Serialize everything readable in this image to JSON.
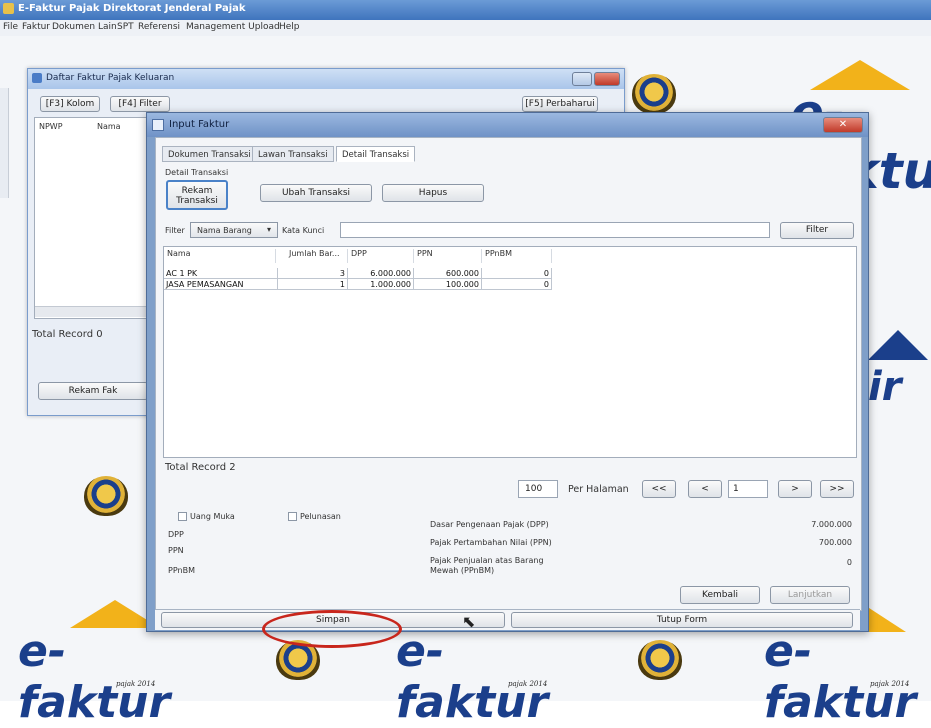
{
  "app": {
    "title": "E-Faktur Pajak Direktorat Jenderal Pajak",
    "menu": [
      "File",
      "Faktur",
      "Dokumen Lain",
      "SPT",
      "Referensi",
      "Management Upload",
      "Help"
    ]
  },
  "branding": {
    "logo_word": "e-faktur",
    "logo_sub": "pajak 2014"
  },
  "daftar_window": {
    "title": "Daftar Faktur Pajak Keluaran",
    "btn_kolom": "[F3] Kolom",
    "btn_filter": "[F4] Filter",
    "btn_perbaharui": "[F5] Perbaharui",
    "col_npwp": "NPWP",
    "col_nama": "Nama",
    "total_record": "Total Record 0",
    "rekam_faktur": "Rekam Fak"
  },
  "input_faktur": {
    "title": "Input Faktur",
    "tabs": [
      "Dokumen Transaksi",
      "Lawan Transaksi",
      "Detail Transaksi"
    ],
    "group_label": "Detail Transaksi",
    "btn_rekam": "Rekam Transaksi",
    "btn_ubah": "Ubah Transaksi",
    "btn_hapus": "Hapus",
    "filter_label": "Filter",
    "filter_field": "Nama Barang",
    "kata_kunci": "Kata Kunci",
    "btn_filter": "Filter",
    "columns": [
      "Nama",
      "Jumlah Bar...",
      "DPP",
      "PPN",
      "PPnBM"
    ],
    "rows": [
      {
        "nama": "AC 1 PK",
        "jumlah": "3",
        "dpp": "6.000.000",
        "ppn": "600.000",
        "ppnbm": "0"
      },
      {
        "nama": "JASA PEMASANGAN",
        "jumlah": "1",
        "dpp": "1.000.000",
        "ppn": "100.000",
        "ppnbm": "0"
      }
    ],
    "total_record": "Total Record 2",
    "per_halaman_value": "100",
    "per_halaman_label": "Per Halaman",
    "page_value": "1",
    "nav": {
      "first": "<<",
      "prev": "<",
      "next": ">",
      "last": ">>"
    },
    "uang_muka": "Uang Muka",
    "pelunasan": "Pelunasan",
    "left_labels": [
      "DPP",
      "PPN",
      "PPnBM"
    ],
    "summary": [
      {
        "label": "Dasar Pengenaan Pajak (DPP)",
        "value": "7.000.000"
      },
      {
        "label": "Pajak Pertambahan Nilai (PPN)",
        "value": "700.000"
      },
      {
        "label": "Pajak Penjualan atas Barang Mewah (PPnBM)",
        "value": "0"
      }
    ],
    "btn_kembali": "Kembali",
    "btn_lanjutkan": "Lanjutkan",
    "btn_simpan": "Simpan",
    "btn_tutup": "Tutup Form"
  }
}
